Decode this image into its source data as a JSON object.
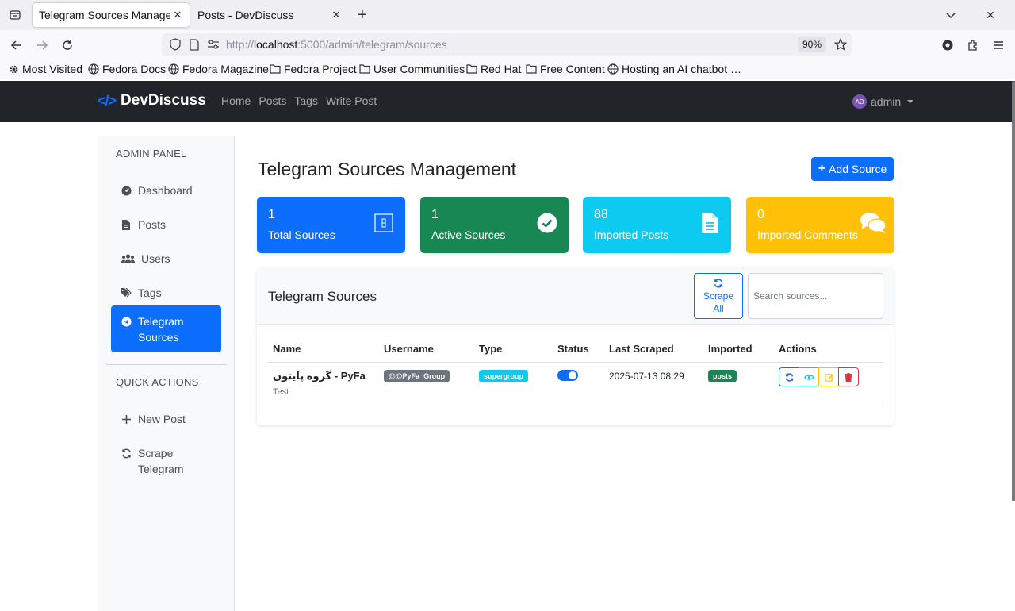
{
  "browser": {
    "tabs": [
      {
        "title": "Telegram Sources Management",
        "active": true
      },
      {
        "title": "Posts - DevDiscuss",
        "active": false
      }
    ],
    "url_scheme": "http://",
    "url_host": "localhost",
    "url_path": ":5000/admin/telegram/sources",
    "zoom": "90%",
    "bookmarks": [
      "Most Visited",
      "Fedora Docs",
      "Fedora Magazine",
      "Fedora Project",
      "User Communities",
      "Red Hat",
      "Free Content",
      "Hosting an AI chatbot …"
    ]
  },
  "app": {
    "brand": "DevDiscuss",
    "brand_icon": "</>",
    "nav": [
      "Home",
      "Posts",
      "Tags",
      "Write Post"
    ],
    "user": {
      "initials": "AD",
      "name": "admin"
    }
  },
  "sidebar": {
    "admin_heading": "ADMIN PANEL",
    "items": [
      {
        "label": "Dashboard",
        "icon": "dashboard-icon"
      },
      {
        "label": "Posts",
        "icon": "file-icon"
      },
      {
        "label": "Users",
        "icon": "users-icon"
      },
      {
        "label": "Tags",
        "icon": "tags-icon"
      },
      {
        "label": "Telegram Sources",
        "icon": "telegram-icon",
        "active": true
      }
    ],
    "quick_heading": "QUICK ACTIONS",
    "quick": [
      {
        "label": "New Post",
        "icon": "plus-icon"
      },
      {
        "label": "Scrape Telegram",
        "icon": "sync-icon"
      }
    ]
  },
  "main": {
    "title": "Telegram Sources Management",
    "add_button": "Add Source",
    "stats": [
      {
        "value": "1",
        "label": "Total Sources",
        "color": "#0d6efd",
        "icon": "telegram-badge-icon"
      },
      {
        "value": "1",
        "label": "Active Sources",
        "color": "#198754",
        "icon": "check-circle-icon"
      },
      {
        "value": "88",
        "label": "Imported Posts",
        "color": "#0dcaf0",
        "icon": "document-icon"
      },
      {
        "value": "0",
        "label": "Imported Comments",
        "color": "#ffc107",
        "icon": "comments-icon"
      }
    ],
    "card": {
      "title": "Telegram Sources",
      "scrape_all_1": "Scrape",
      "scrape_all_2": "All",
      "search_placeholder": "Search sources...",
      "columns": [
        "Name",
        "Username",
        "Type",
        "Status",
        "Last Scraped",
        "Imported",
        "Actions"
      ],
      "rows": [
        {
          "name": "گروه پایتون - PyFa",
          "description": "Test",
          "username": "@@PyFa_Group",
          "type": "supergroup",
          "status_on": true,
          "last_scraped": "2025-07-13 08:29",
          "imported": "posts"
        }
      ]
    }
  }
}
